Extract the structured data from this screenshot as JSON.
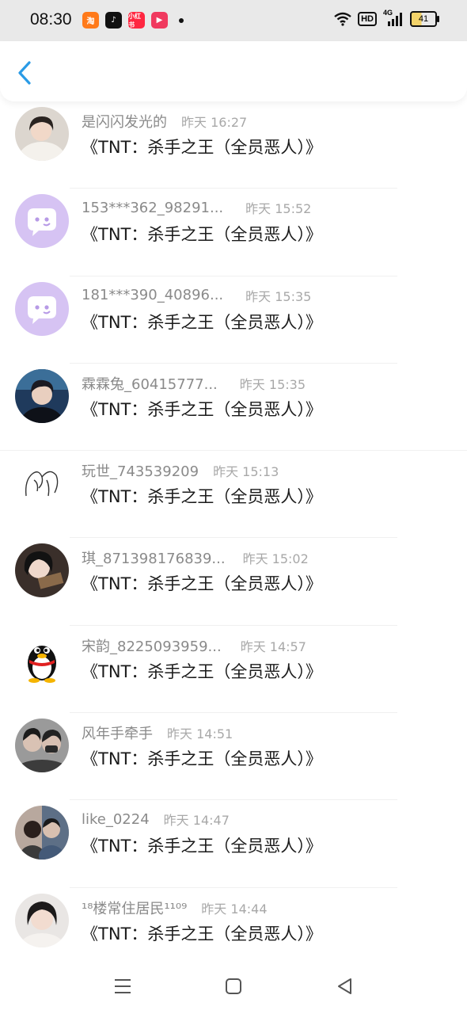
{
  "status_bar": {
    "time": "08:30",
    "hd": "HD",
    "network": "4G",
    "battery": "41"
  },
  "app_icons": [
    "taobao-icon",
    "tiktok-icon",
    "xiaohongshu-icon",
    "video-player-icon"
  ],
  "header": {
    "back_icon": "chevron-left-icon"
  },
  "comments": [
    {
      "name": "是闪闪发光的",
      "time": "昨天 16:27",
      "text": "《TNT：杀手之王（全员恶人）》",
      "avatar": "photo-girl-white"
    },
    {
      "name": "153***362_98291...",
      "time": "昨天 15:52",
      "text": "《TNT：杀手之王（全员恶人）》",
      "avatar": "default-chat-bubble"
    },
    {
      "name": "181***390_40896...",
      "time": "昨天 15:35",
      "text": "《TNT：杀手之王（全员恶人）》",
      "avatar": "default-chat-bubble"
    },
    {
      "name": "霖霖兔_60415777...",
      "time": "昨天 15:35",
      "text": "《TNT：杀手之王（全员恶人）》",
      "avatar": "photo-boy-dark"
    },
    {
      "name": "玩世_743539209",
      "time": "昨天 15:13",
      "text": "《TNT：杀手之王（全员恶人）》",
      "avatar": "line-sketch"
    },
    {
      "name": "琪_871398176839...",
      "time": "昨天 15:02",
      "text": "《TNT：杀手之王（全员恶人）》",
      "avatar": "photo-girl-dark"
    },
    {
      "name": "宋韵_8225093959...",
      "time": "昨天 14:57",
      "text": "《TNT：杀手之王（全员恶人）》",
      "avatar": "qq-penguin"
    },
    {
      "name": "风年手牵手",
      "time": "昨天 14:51",
      "text": "《TNT：杀手之王（全员恶人）》",
      "avatar": "photo-couple"
    },
    {
      "name": "like_0224",
      "time": "昨天 14:47",
      "text": "《TNT：杀手之王（全员恶人）》",
      "avatar": "photo-couple-warm"
    },
    {
      "name": "¹⁸楼常住居民¹¹⁰⁹",
      "time": "昨天 14:44",
      "text": "《TNT：杀手之王（全员恶人）》",
      "avatar": "photo-girl-light"
    }
  ],
  "nav": {
    "menu_icon": "menu-icon",
    "home_icon": "home-square-icon",
    "back_icon": "back-triangle-icon"
  },
  "colors": {
    "accent": "#2a9be6",
    "default_avatar": "#d6c3f3",
    "name": "#8a8a8a",
    "text": "#1a1a1a"
  }
}
